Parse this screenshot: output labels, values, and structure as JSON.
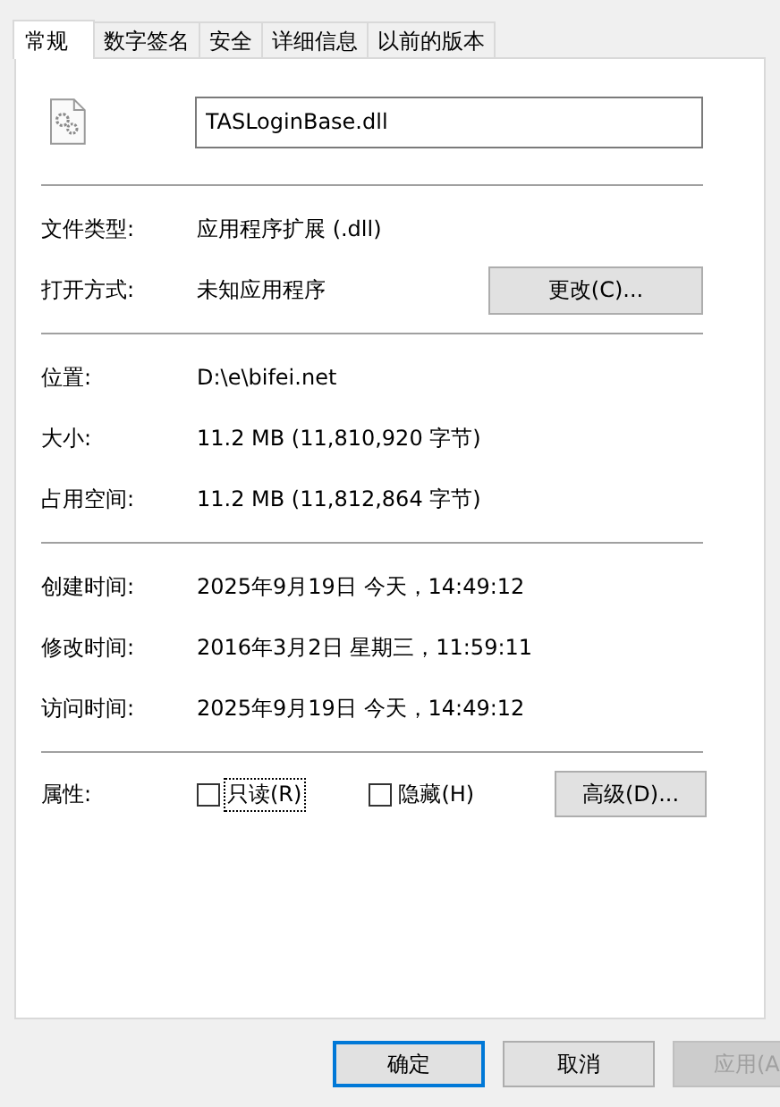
{
  "tabs": [
    {
      "label": "常规",
      "selected": true
    },
    {
      "label": "数字签名",
      "selected": false
    },
    {
      "label": "安全",
      "selected": false
    },
    {
      "label": "详细信息",
      "selected": false
    },
    {
      "label": "以前的版本",
      "selected": false
    }
  ],
  "file": {
    "name": "TASLoginBase.dll"
  },
  "sections": [
    [
      {
        "label": "文件类型:",
        "value": "应用程序扩展 (.dll)"
      },
      {
        "label": "打开方式:",
        "value": "未知应用程序",
        "button": "更改(C)..."
      }
    ],
    [
      {
        "label": "位置:",
        "value": "D:\\e\\bifei.net"
      },
      {
        "label": "大小:",
        "value": "11.2 MB (11,810,920 字节)"
      },
      {
        "label": "占用空间:",
        "value": "11.2 MB (11,812,864 字节)"
      }
    ],
    [
      {
        "label": "创建时间:",
        "value": "2025年9月19日 今天，14:49:12"
      },
      {
        "label": "修改时间:",
        "value": "2016年3月2日 星期三，11:59:11"
      },
      {
        "label": "访问时间:",
        "value": "2025年9月19日 今天，14:49:12"
      }
    ]
  ],
  "attributes": {
    "label": "属性:",
    "options": [
      {
        "label": "只读(R)",
        "checked": false,
        "focused": true
      },
      {
        "label": "隐藏(H)",
        "checked": false,
        "focused": false
      }
    ],
    "button": "高级(D)..."
  },
  "buttons": [
    {
      "label": "确定",
      "default": true,
      "disabled": false
    },
    {
      "label": "取消",
      "default": false,
      "disabled": false
    },
    {
      "label": "应用(A",
      "default": false,
      "disabled": true
    }
  ]
}
